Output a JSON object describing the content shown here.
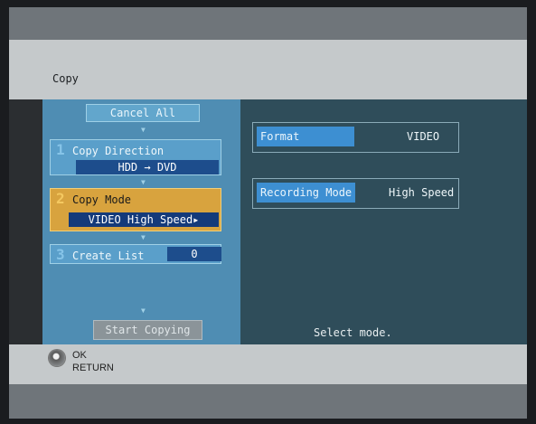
{
  "screen": {
    "title": "Copy",
    "status_message": "Select mode."
  },
  "steps": {
    "cancel_label": "Cancel All",
    "step1": {
      "number": "1",
      "label": "Copy Direction",
      "value": "HDD  →  DVD"
    },
    "step2": {
      "number": "2",
      "label": "Copy Mode",
      "value": "VIDEO  High Speed▸"
    },
    "step3": {
      "number": "3",
      "label": "Create List",
      "value": "0"
    },
    "start_label": "Start Copying"
  },
  "info": {
    "format_label": "Format",
    "format_value": "VIDEO",
    "recording_mode_label": "Recording Mode",
    "recording_mode_value": "High Speed"
  },
  "footer": {
    "ok_label": "OK",
    "return_label": "RETURN",
    "remote_icon": "remote-dpad-icon"
  },
  "colors": {
    "left_panel": "#4f8db3",
    "right_panel": "#2f4d5a",
    "selected_step": "#d8a33e",
    "title_bar": "#c5c9cb",
    "label_highlight": "#3d8fd2"
  }
}
